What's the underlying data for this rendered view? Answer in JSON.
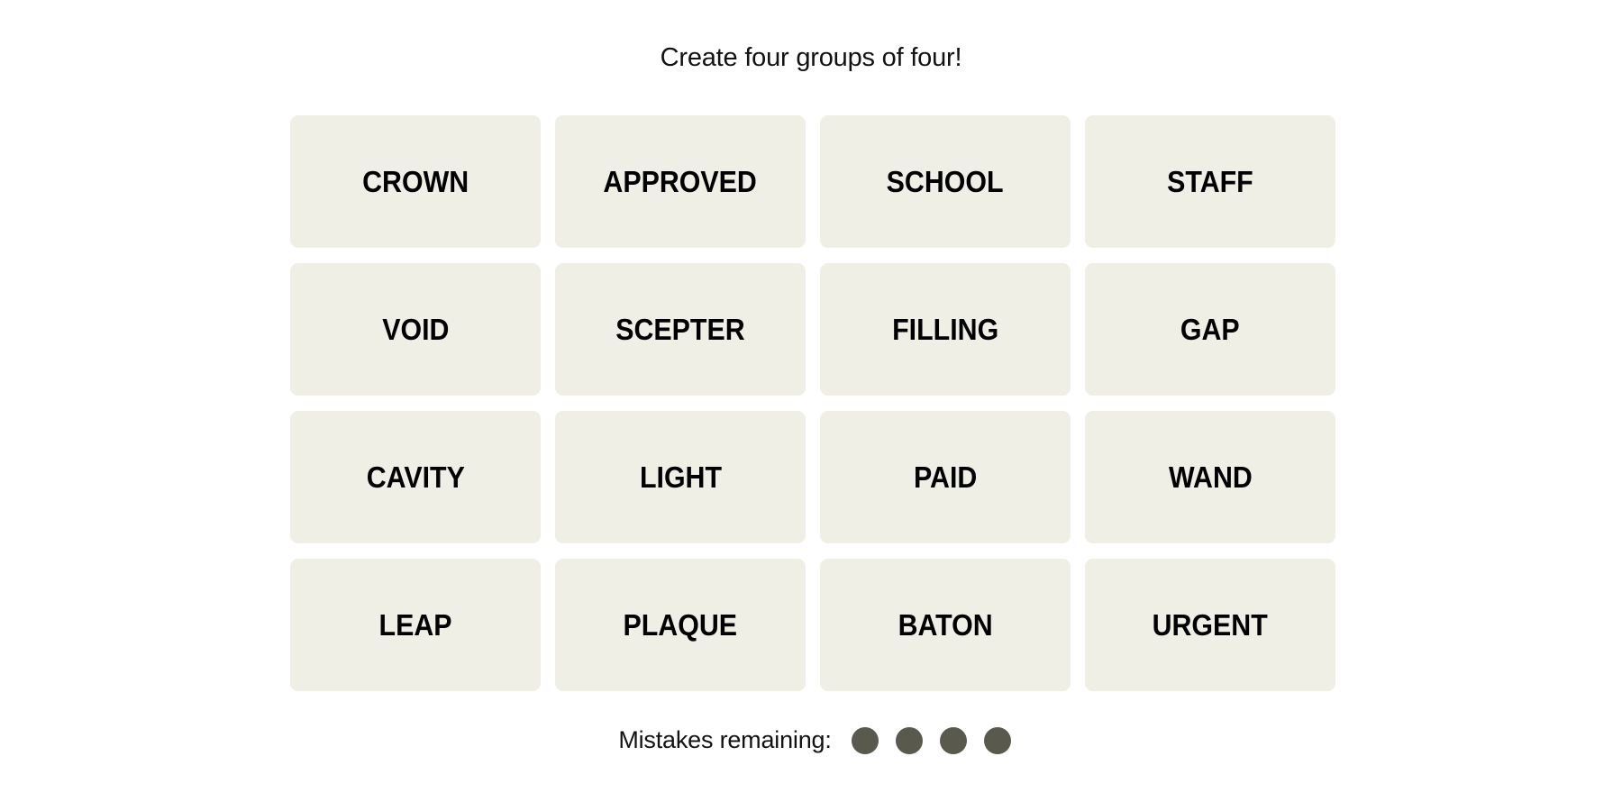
{
  "game": {
    "subtitle": "Create four groups of four!",
    "tiles": [
      "CROWN",
      "APPROVED",
      "SCHOOL",
      "STAFF",
      "VOID",
      "SCEPTER",
      "FILLING",
      "GAP",
      "CAVITY",
      "LIGHT",
      "PAID",
      "WAND",
      "LEAP",
      "PLAQUE",
      "BATON",
      "URGENT"
    ],
    "mistakes": {
      "label": "Mistakes remaining:",
      "remaining": 4,
      "total": 4,
      "dot_color": "#5a594e"
    },
    "colors": {
      "tile_background": "#efefe6",
      "tile_text": "#000000"
    }
  }
}
